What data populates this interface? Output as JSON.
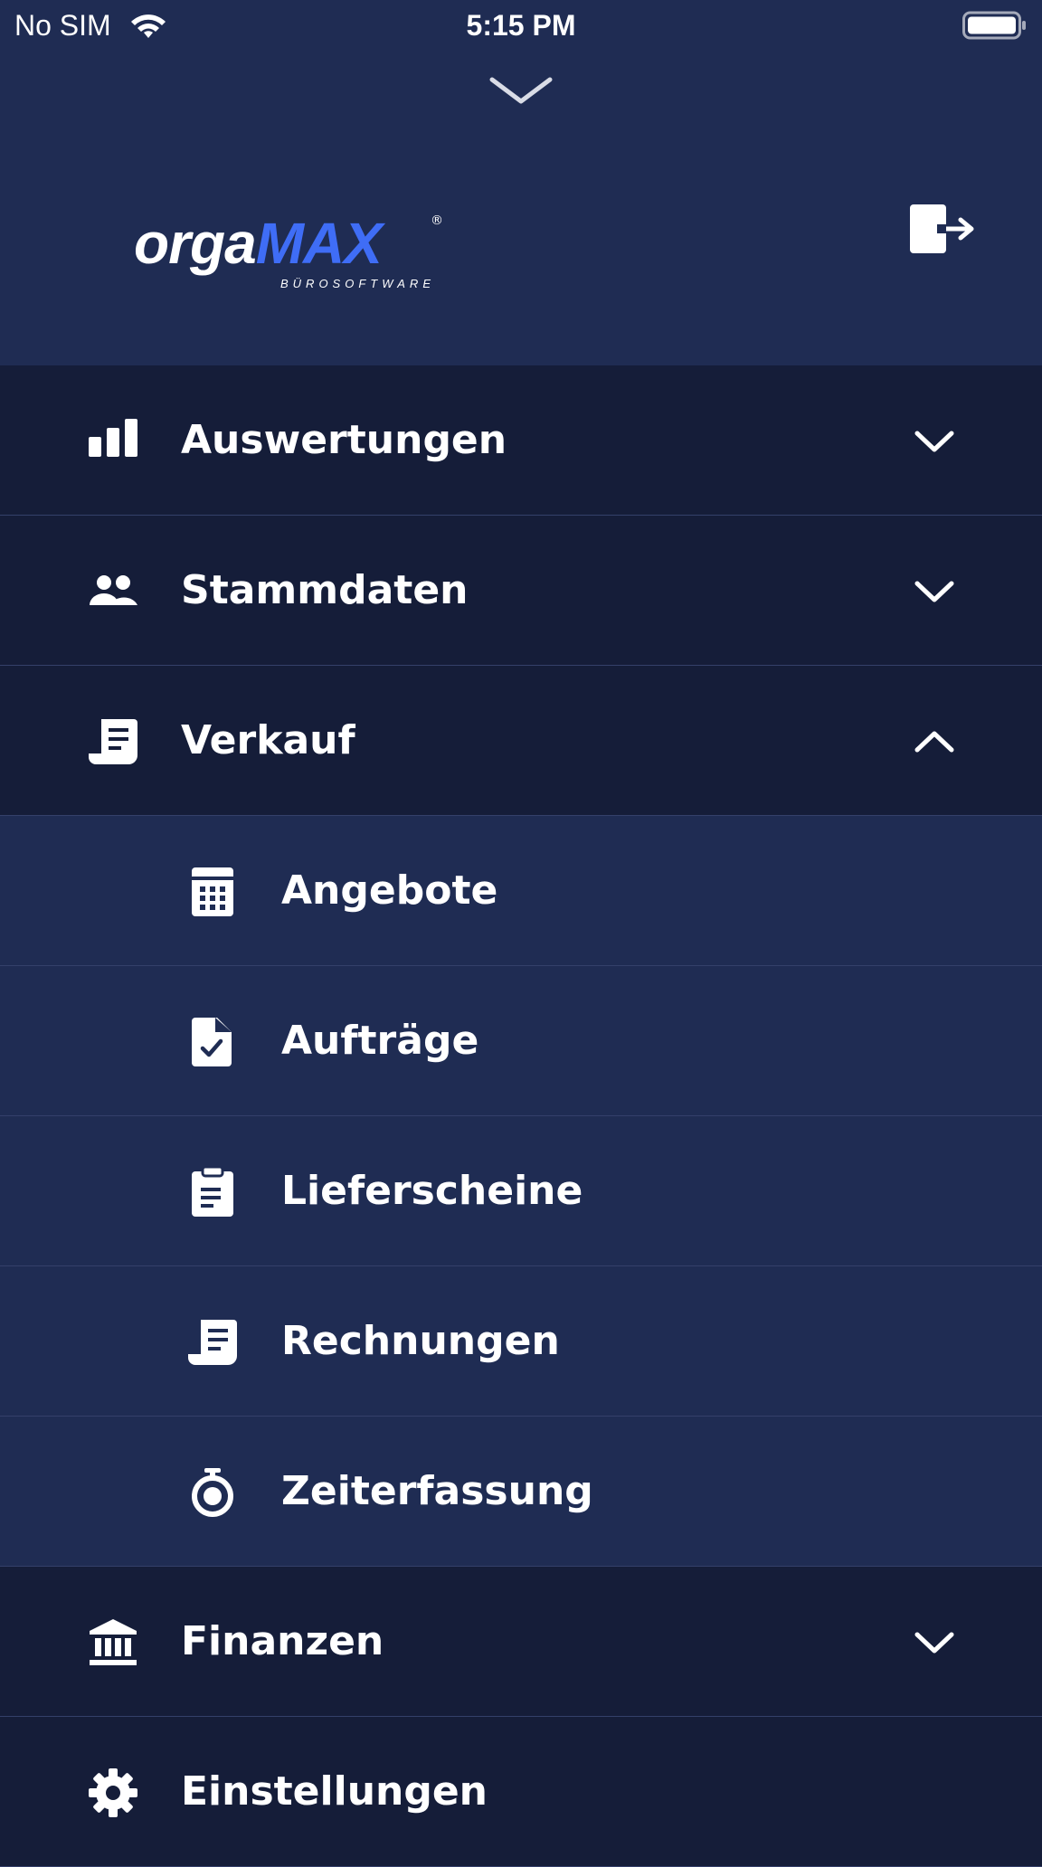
{
  "status_bar": {
    "carrier": "No SIM",
    "time": "5:15 PM",
    "wifi_icon": "wifi-icon",
    "battery_icon": "battery-full-icon"
  },
  "header": {
    "pull_handle_icon": "chevron-down-icon",
    "logo": {
      "orga": "orga",
      "max": "MAX",
      "registered": "®",
      "tagline": "BÜROSOFTWARE"
    },
    "logout_icon": "logout-icon",
    "colors": {
      "background": "#1f2c53",
      "brand_accent": "#3f6df6"
    }
  },
  "menu": {
    "items": [
      {
        "label": "Auswertungen",
        "icon": "bar-chart-icon",
        "expanded": false
      },
      {
        "label": "Stammdaten",
        "icon": "users-icon",
        "expanded": false
      },
      {
        "label": "Verkauf",
        "icon": "receipt-icon",
        "expanded": true,
        "children": [
          {
            "label": "Angebote",
            "icon": "calculator-icon"
          },
          {
            "label": "Aufträge",
            "icon": "file-check-icon"
          },
          {
            "label": "Lieferscheine",
            "icon": "clipboard-icon"
          },
          {
            "label": "Rechnungen",
            "icon": "receipt-icon"
          },
          {
            "label": "Zeiterfassung",
            "icon": "stopwatch-icon"
          }
        ]
      },
      {
        "label": "Finanzen",
        "icon": "bank-icon",
        "expanded": false
      },
      {
        "label": "Einstellungen",
        "icon": "gear-icon",
        "expanded": false
      }
    ],
    "colors": {
      "top_level_bg": "#151d39",
      "sub_level_bg": "#1f2c53",
      "divider": "#34406a"
    }
  }
}
